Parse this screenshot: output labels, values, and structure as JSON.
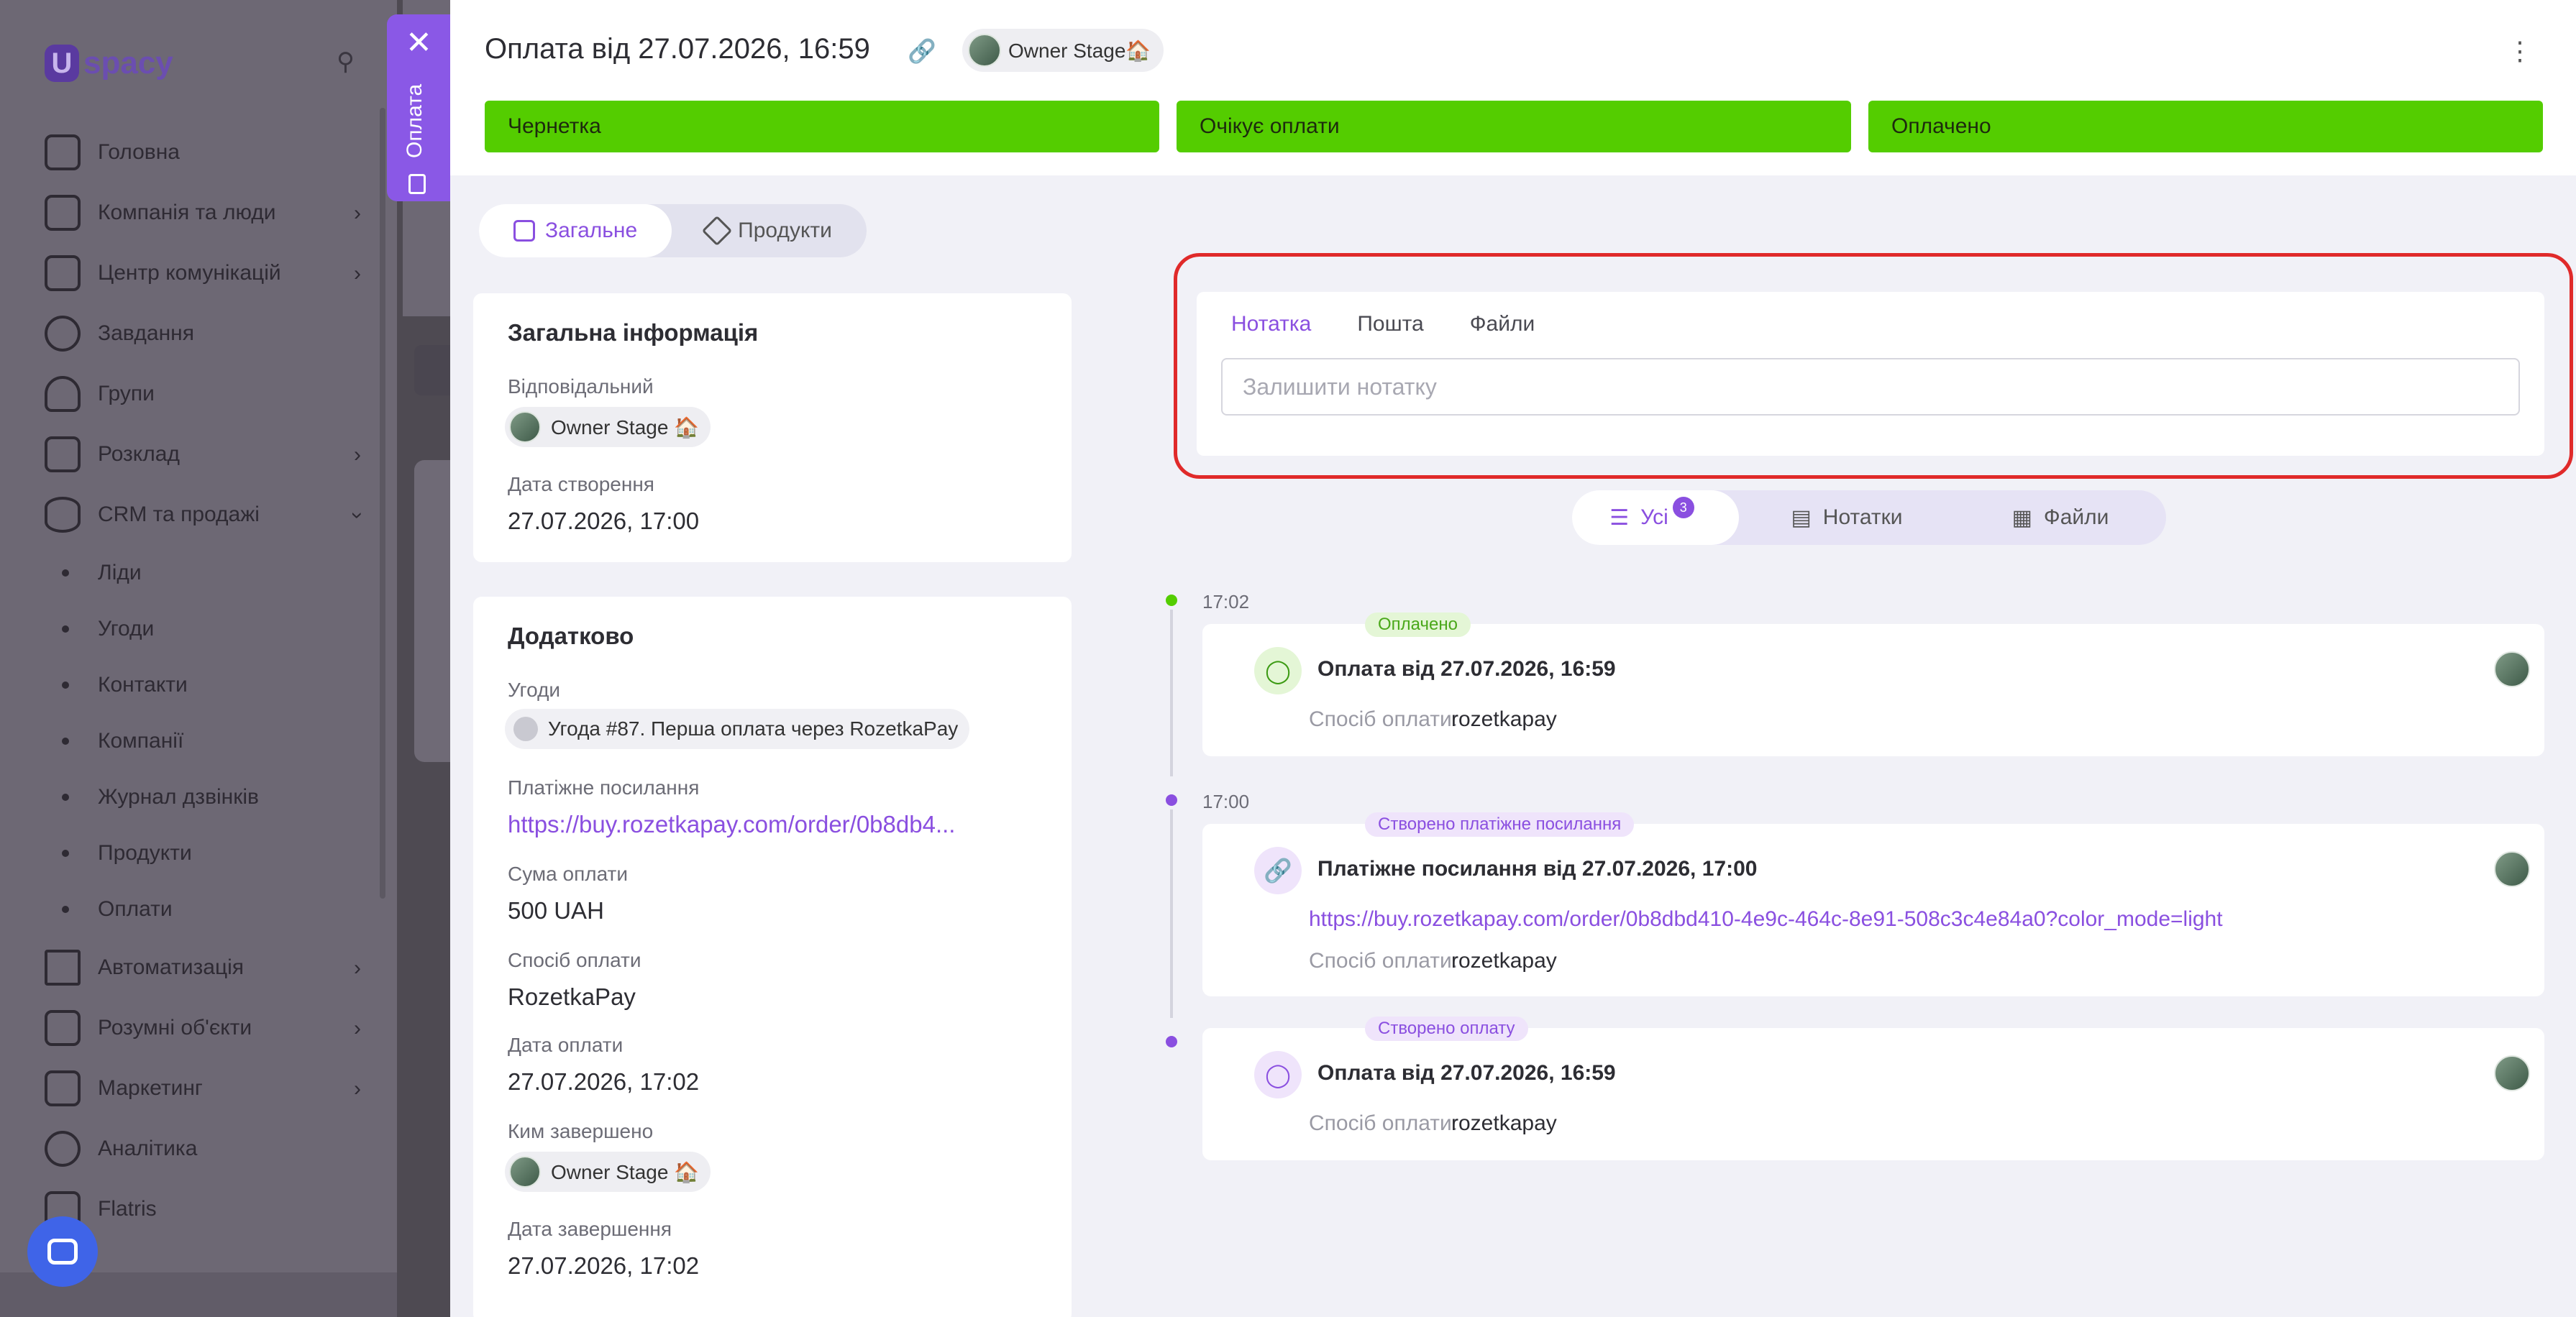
{
  "sidebar": {
    "logo_letter": "U",
    "logo_text": "spacy",
    "items": [
      {
        "label": "Головна",
        "icon": "home-icon"
      },
      {
        "label": "Компанія та люди",
        "icon": "building-icon",
        "chevron": true
      },
      {
        "label": "Центр комунікацій",
        "icon": "chat-edit-icon",
        "chevron": true
      },
      {
        "label": "Завдання",
        "icon": "check-circle-icon"
      },
      {
        "label": "Групи",
        "icon": "users-icon"
      },
      {
        "label": "Розклад",
        "icon": "calendar-icon",
        "chevron": true
      },
      {
        "label": "CRM та продажі",
        "icon": "database-icon",
        "chevron": true
      }
    ],
    "crm_sub": [
      "Ліди",
      "Угоди",
      "Контакти",
      "Компанії",
      "Журнал дзвінків",
      "Продукти",
      "Оплати"
    ],
    "items_after": [
      {
        "label": "Автоматизація",
        "icon": "lightning-icon",
        "chevron": true
      },
      {
        "label": "Розумні об'єкти",
        "icon": "smart-object-icon",
        "chevron": true
      },
      {
        "label": "Маркетинг",
        "icon": "marketing-icon",
        "chevron": true
      },
      {
        "label": "Аналітика",
        "icon": "analytics-icon"
      },
      {
        "label": "Flatris",
        "icon": "flatris-icon"
      }
    ]
  },
  "drawer_tab": {
    "label": "Оплата"
  },
  "header": {
    "title": "Оплата від 27.07.2026, 16:59",
    "owner": "Owner Stage🏠",
    "stages": [
      "Чернетка",
      "Очікує оплати",
      "Оплачено"
    ]
  },
  "tabs": {
    "general": "Загальне",
    "products": "Продукти"
  },
  "general_info": {
    "title": "Загальна інформація",
    "responsible_label": "Відповідальний",
    "responsible": "Owner Stage 🏠",
    "created_label": "Дата створення",
    "created": "27.07.2026, 17:00"
  },
  "additional": {
    "title": "Додатково",
    "deals_label": "Угоди",
    "deal": "Угода #87. Перша оплата через RozetkaPay",
    "link_label": "Платіжне посилання",
    "link": "https://buy.rozetkapay.com/order/0b8db4...",
    "amount_label": "Сума оплати",
    "amount": "500 UAH",
    "method_label": "Спосіб оплати",
    "method": "RozetkaPay",
    "paid_label": "Дата оплати",
    "paid": "27.07.2026, 17:02",
    "completed_by_label": "Ким завершено",
    "completed_by": "Owner Stage 🏠",
    "completed_label": "Дата завершення",
    "completed": "27.07.2026, 17:02"
  },
  "note": {
    "tabs": [
      "Нотатка",
      "Пошта",
      "Файли"
    ],
    "placeholder": "Залишити нотатку"
  },
  "feed_filter": {
    "all": "Усі",
    "all_count": "3",
    "notes": "Нотатки",
    "files": "Файли"
  },
  "colors": {
    "accent": "#8a4fe0",
    "stage_green": "#54cd00",
    "highlight_red": "#e02a2a"
  },
  "timeline": [
    {
      "time": "17:02",
      "tag": "Оплачено",
      "title": "Оплата від 27.07.2026, 16:59",
      "method_label": "Спосіб оплати:",
      "method": "rozetkapay"
    },
    {
      "time": "17:00",
      "tag": "Створено платіжне посилання",
      "title": "Платіжне посилання від 27.07.2026, 17:00",
      "link": "https://buy.rozetkapay.com/order/0b8dbd410-4e9c-464c-8e91-508c3c4e84a0?color_mode=light",
      "method_label": "Спосіб оплати:",
      "method": "rozetkapay"
    },
    {
      "time": "",
      "tag": "Створено оплату",
      "title": "Оплата від 27.07.2026, 16:59",
      "method_label": "Спосіб оплати:",
      "method": "rozetkapay"
    }
  ]
}
